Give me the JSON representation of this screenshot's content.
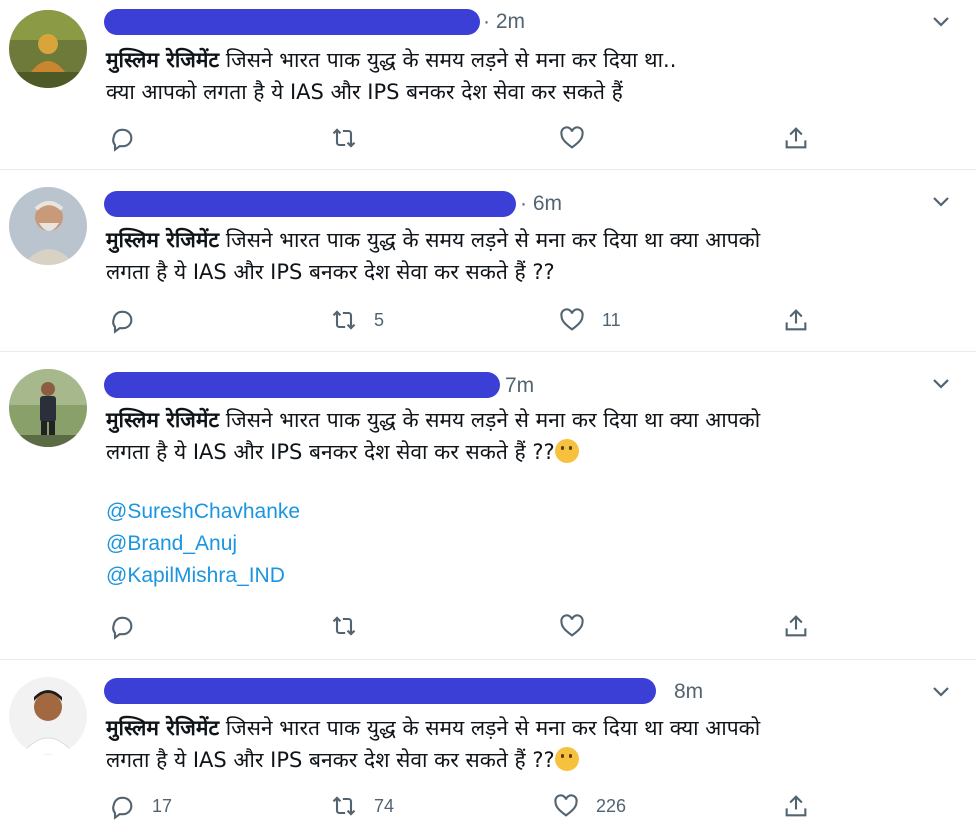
{
  "colors": {
    "redaction": "#3b3fd6",
    "link": "#1b95e0",
    "muted": "#536471"
  },
  "tweets": [
    {
      "time": "· 2m",
      "bold": "मुस्लिम रेजिमेंट",
      "line1": " जिसने भारत पाक युद्ध के समय लड़ने से मना कर दिया था..",
      "line2": " क्या आपको लगता है ये IAS और IPS  बनकर देश सेवा कर सकते हैं",
      "reply_count": "",
      "retweet_count": "",
      "like_count": "",
      "emoji": false,
      "mentions": []
    },
    {
      "time": "· 6m",
      "bold": "मुस्लिम रेजिमेंट",
      "line1": " जिसने भारत पाक युद्ध के समय लड़ने से मना कर दिया था क्या आपको",
      "line2": "लगता है ये IAS और IPS  बनकर देश सेवा कर सकते हैं ??",
      "reply_count": "",
      "retweet_count": "5",
      "like_count": "11",
      "emoji": false,
      "mentions": []
    },
    {
      "time": "7m",
      "bold": "मुस्लिम रेजिमेंट",
      "line1": " जिसने भारत पाक युद्ध के समय लड़ने से मना कर दिया था क्या आपको",
      "line2": "लगता है ये IAS और IPS  बनकर देश सेवा कर सकते हैं ??",
      "reply_count": "",
      "retweet_count": "",
      "like_count": "",
      "emoji": true,
      "mentions": [
        "@SureshChavhanke",
        "@Brand_Anuj",
        "@KapilMishra_IND"
      ]
    },
    {
      "time": "8m",
      "bold": "मुस्लिम रेजिमेंट",
      "line1": " जिसने भारत पाक युद्ध के समय लड़ने से मना कर दिया था क्या आपको",
      "line2": "लगता है ये IAS और IPS  बनकर देश सेवा कर सकते हैं ??",
      "reply_count": "17",
      "retweet_count": "74",
      "like_count": "226",
      "emoji": true,
      "mentions": []
    }
  ]
}
